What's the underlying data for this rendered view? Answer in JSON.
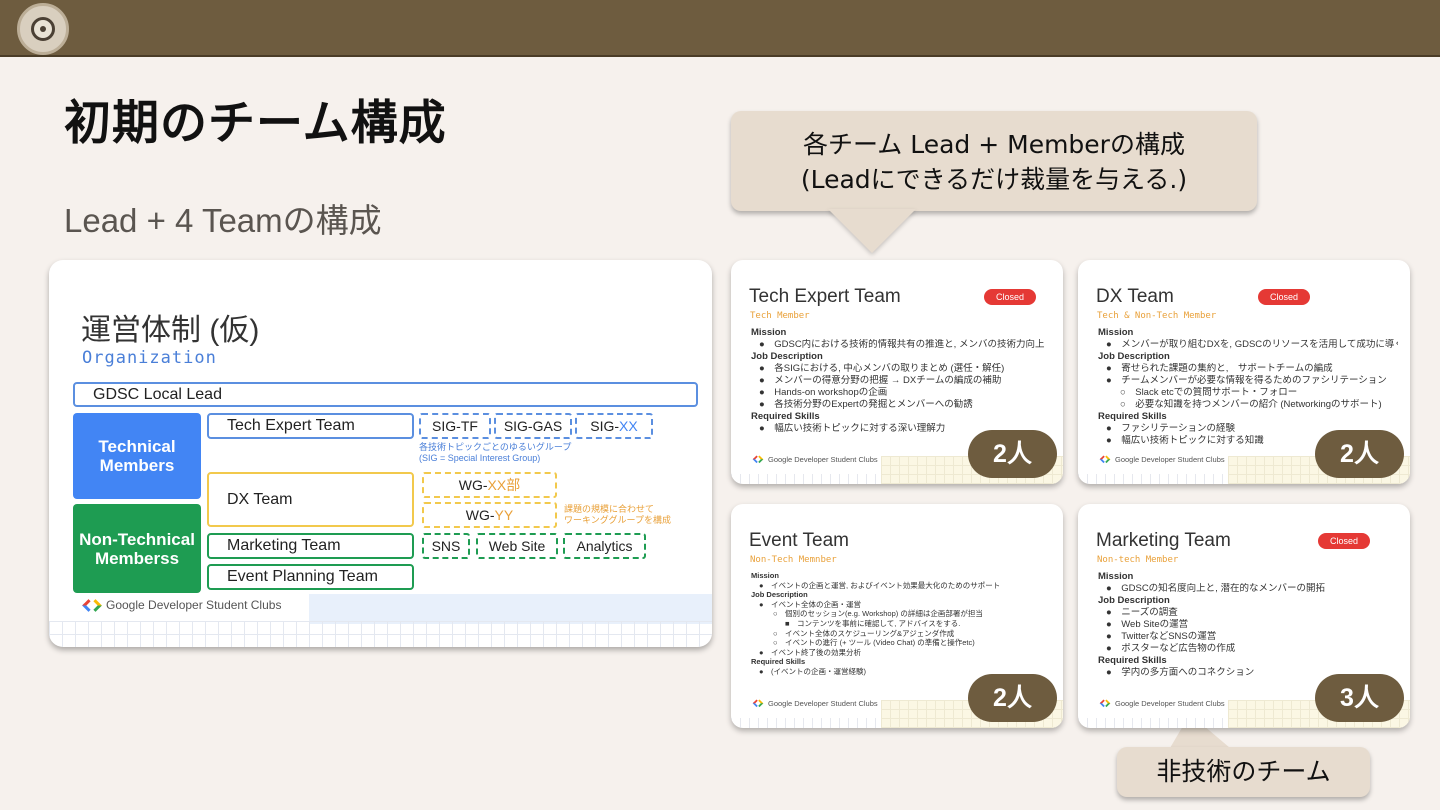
{
  "header": {
    "logo_icon": "gdsc-logo-icon"
  },
  "page": {
    "title": "初期のチーム構成",
    "subtitle": "Lead + 4 Teamの構成"
  },
  "callouts": {
    "top_line1": "各チーム Lead + Memberの構成",
    "top_line2": "(Leadにできるだけ裁量を与える.)",
    "bottom": "非技術のチーム"
  },
  "org": {
    "title": "運営体制 (仮)",
    "subtitle": "Organization",
    "lead": "GDSC Local Lead",
    "technical": "Technical Members",
    "nontechnical": "Non-Technical Memberss",
    "teams": {
      "tech_expert": "Tech Expert Team",
      "dx": "DX Team",
      "marketing": "Marketing Team",
      "event": "Event Planning Team"
    },
    "sig": {
      "tf": "SIG-TF",
      "gas": "SIG-GAS",
      "xx_prefix": "SIG-",
      "xx_suffix": "XX"
    },
    "sig_note1": "各技術トピックごとのゆるいグループ",
    "sig_note2": "(SIG = Special Interest Group)",
    "wg": {
      "xx_prefix": "WG-",
      "xx_suffix": "XX部",
      "yy_prefix": "WG-",
      "yy_suffix": "YY"
    },
    "wg_note1": "課題の規模に合わせて",
    "wg_note2": "ワーキンググループを構成",
    "marketing_sub": {
      "sns": "SNS",
      "web": "Web Site",
      "analytics": "Analytics"
    },
    "footer": "Google Developer Student Clubs",
    "colors": {
      "blue": "#4285f4",
      "green": "#1e9c52",
      "yellow": "#f2c94c"
    }
  },
  "cards": {
    "tech": {
      "title": "Tech Expert Team",
      "role": "Tech Member",
      "badge": "Closed",
      "mission_h": "Mission",
      "mission": "●　GDSC内における技術的情報共有の推進と, メンバの技術力向上",
      "job_h": "Job Description",
      "job1": "●　各SIGにおける, 中心メンバの取りまとめ (選任・解任)",
      "job2": "●　メンバーの得意分野の把握 → DXチームの編成の補助",
      "job3": "●　Hands-on workshopの企画",
      "job4": "●　各技術分野のExpertの発掘とメンバーへの勧誘",
      "skill_h": "Required Skills",
      "skill1": "●　幅広い技術トピックに対する深い理解力",
      "footer": "Google Developer Student Clubs",
      "count": "2人"
    },
    "dx": {
      "title": "DX Team",
      "role": "Tech & Non-Tech Member",
      "badge": "Closed",
      "mission_h": "Mission",
      "mission": "●　メンバーが取り組むDXを, GDSCのリソースを活用して成功に導く",
      "job_h": "Job Description",
      "job1": "●　寄せられた課題の集約と,　サポートチームの編成",
      "job2": "●　チームメンバーが必要な情報を得るためのファシリテーション",
      "job3": "○　Slack etcでの質問サポート・フォロー",
      "job4": "○　必要な知識を持つメンバーの紹介 (Networkingのサポート)",
      "skill_h": "Required Skills",
      "skill1": "●　ファシリテーションの経験",
      "skill2": "●　幅広い技術トピックに対する知識",
      "footer": "Google Developer Student Clubs",
      "count": "2人"
    },
    "event": {
      "title": "Event Team",
      "role": "Non-Tech Memnber",
      "mission_h": "Mission",
      "mission": "●　イベントの企画と運営, およびイベント効果最大化のためのサポート",
      "job_h": "Job Description",
      "job1": "●　イベント全体の企画・運営",
      "job2": "○　個別のセッション(e.g. Workshop) の詳細は企画部署が担当",
      "job3": "■　コンテンツを事前に確認して, アドバイスをする.",
      "job4": "○　イベント全体のスケジューリング&アジェンダ作成",
      "job5": "○　イベントの進行 (+ ツール (Video Chat) の準備と操作etc)",
      "job6": "●　イベント終了後の効果分析",
      "skill_h": "Required Skills",
      "skill1": "●　(イベントの企画・運営経験)",
      "footer": "Google Developer Student Clubs",
      "count": "2人"
    },
    "marketing": {
      "title": "Marketing Team",
      "role": "Non-tech Member",
      "badge": "Closed",
      "mission_h": "Mission",
      "mission": "●　GDSCの知名度向上と, 潜在的なメンバーの開拓",
      "job_h": "Job Description",
      "job1": "●　ニーズの調査",
      "job2": "●　Web Siteの運営",
      "job3": "●　TwitterなどSNSの運営",
      "job4": "●　ポスターなど広告物の作成",
      "skill_h": "Required Skills",
      "skill1": "●　学内の多方面へのコネクション",
      "footer": "Google Developer Student Clubs",
      "count": "3人"
    }
  }
}
